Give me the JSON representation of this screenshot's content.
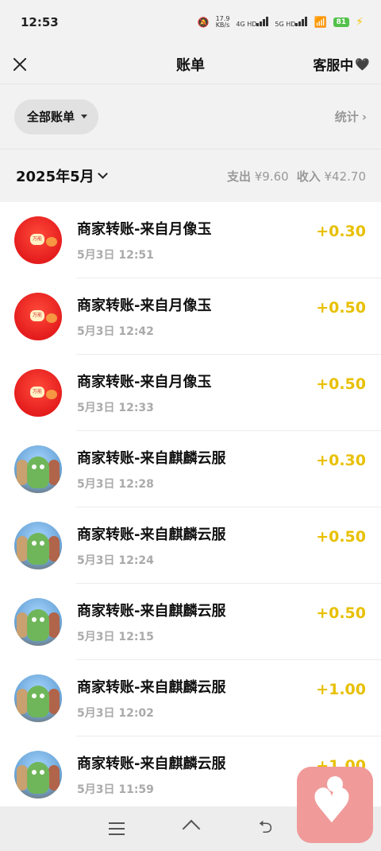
{
  "status_bar": {
    "time": "12:53",
    "speed_value": "17.9",
    "speed_unit": "KB/s",
    "net1": "4G HD",
    "net2": "5G HD",
    "battery": "81"
  },
  "nav": {
    "title": "账单",
    "service_label": "客服中",
    "service_icon": "heart-icon"
  },
  "filter": {
    "label": "全部账单",
    "stats_label": "统计"
  },
  "month_bar": {
    "month": "2025年5月",
    "expense_label": "支出",
    "expense_value": "¥9.60",
    "income_label": "收入",
    "income_value": "¥42.70"
  },
  "transactions": [
    {
      "name": "商家转账-来自月像玉",
      "time": "5月3日 12:51",
      "amount": "+0.30",
      "avatar": "red-envelope",
      "avatar_text": "万能"
    },
    {
      "name": "商家转账-来自月像玉",
      "time": "5月3日 12:42",
      "amount": "+0.50",
      "avatar": "red-envelope",
      "avatar_text": "万能"
    },
    {
      "name": "商家转账-来自月像玉",
      "time": "5月3日 12:33",
      "amount": "+0.50",
      "avatar": "red-envelope",
      "avatar_text": "万能"
    },
    {
      "name": "商家转账-来自麒麟云服",
      "time": "5月3日 12:28",
      "amount": "+0.30",
      "avatar": "character"
    },
    {
      "name": "商家转账-来自麒麟云服",
      "time": "5月3日 12:24",
      "amount": "+0.50",
      "avatar": "character"
    },
    {
      "name": "商家转账-来自麒麟云服",
      "time": "5月3日 12:15",
      "amount": "+0.50",
      "avatar": "character"
    },
    {
      "name": "商家转账-来自麒麟云服",
      "time": "5月3日 12:02",
      "amount": "+1.00",
      "avatar": "character"
    },
    {
      "name": "商家转账-来自麒麟云服",
      "time": "5月3日 11:59",
      "amount": "+1.00",
      "avatar": "character"
    }
  ],
  "colors": {
    "amount": "#e8c000",
    "background": "#f2f2f2",
    "float_button": "#f09a9a"
  }
}
